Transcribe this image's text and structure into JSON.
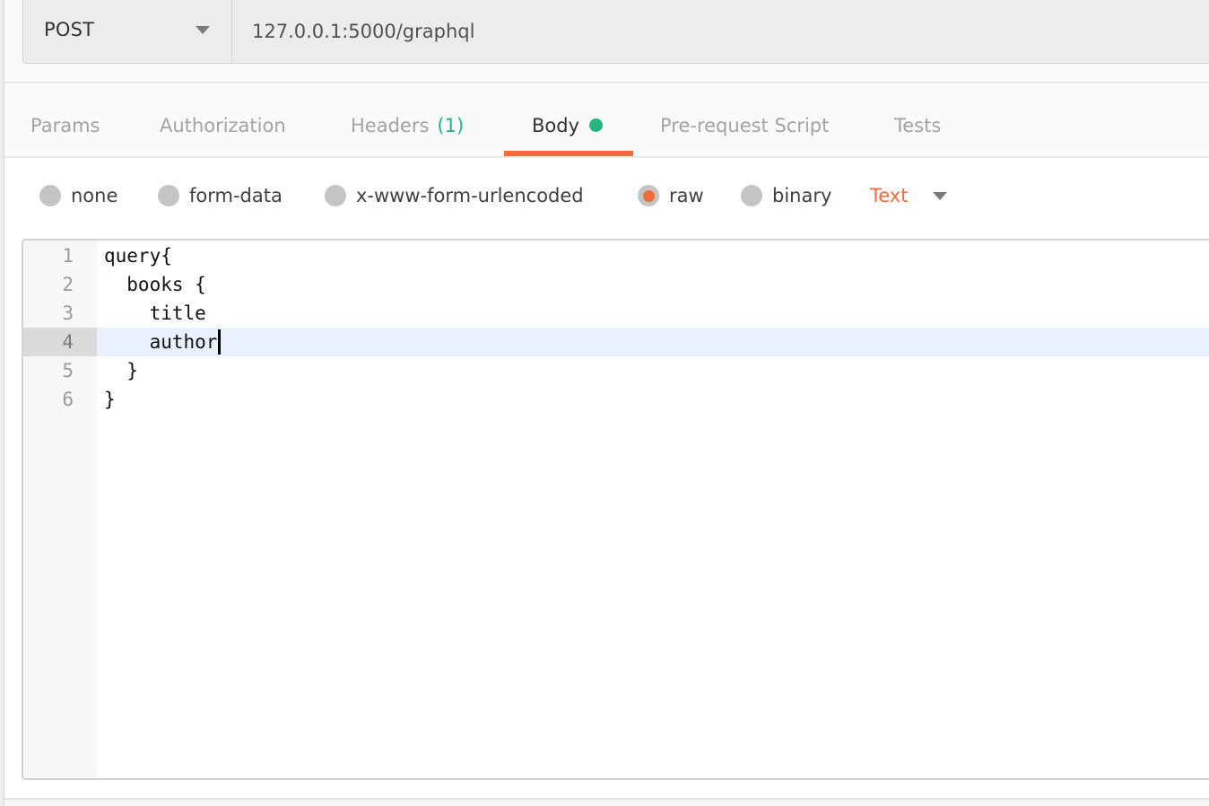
{
  "request": {
    "method": "POST",
    "url": "127.0.0.1:5000/graphql"
  },
  "tabs": [
    {
      "label": "Params",
      "active": false
    },
    {
      "label": "Authorization",
      "active": false
    },
    {
      "label": "Headers",
      "count": "(1)",
      "active": false
    },
    {
      "label": "Body",
      "active": true,
      "indicator": "green-dot"
    },
    {
      "label": "Pre-request Script",
      "active": false
    },
    {
      "label": "Tests",
      "active": false
    }
  ],
  "body_types": [
    {
      "label": "none",
      "checked": false
    },
    {
      "label": "form-data",
      "checked": false
    },
    {
      "label": "x-www-form-urlencoded",
      "checked": false
    },
    {
      "label": "raw",
      "checked": true
    },
    {
      "label": "binary",
      "checked": false
    }
  ],
  "raw_format": {
    "selected": "Text"
  },
  "editor": {
    "active_line": 4,
    "lines": [
      {
        "number": "1",
        "text": "query{"
      },
      {
        "number": "2",
        "text": "  books {"
      },
      {
        "number": "3",
        "text": "    title"
      },
      {
        "number": "4",
        "text": "    author"
      },
      {
        "number": "5",
        "text": "  }"
      },
      {
        "number": "6",
        "text": "}"
      }
    ]
  },
  "colors": {
    "accent": "#f26b3a",
    "success": "#26b47f",
    "active_line_bg": "#e8f1fd"
  }
}
